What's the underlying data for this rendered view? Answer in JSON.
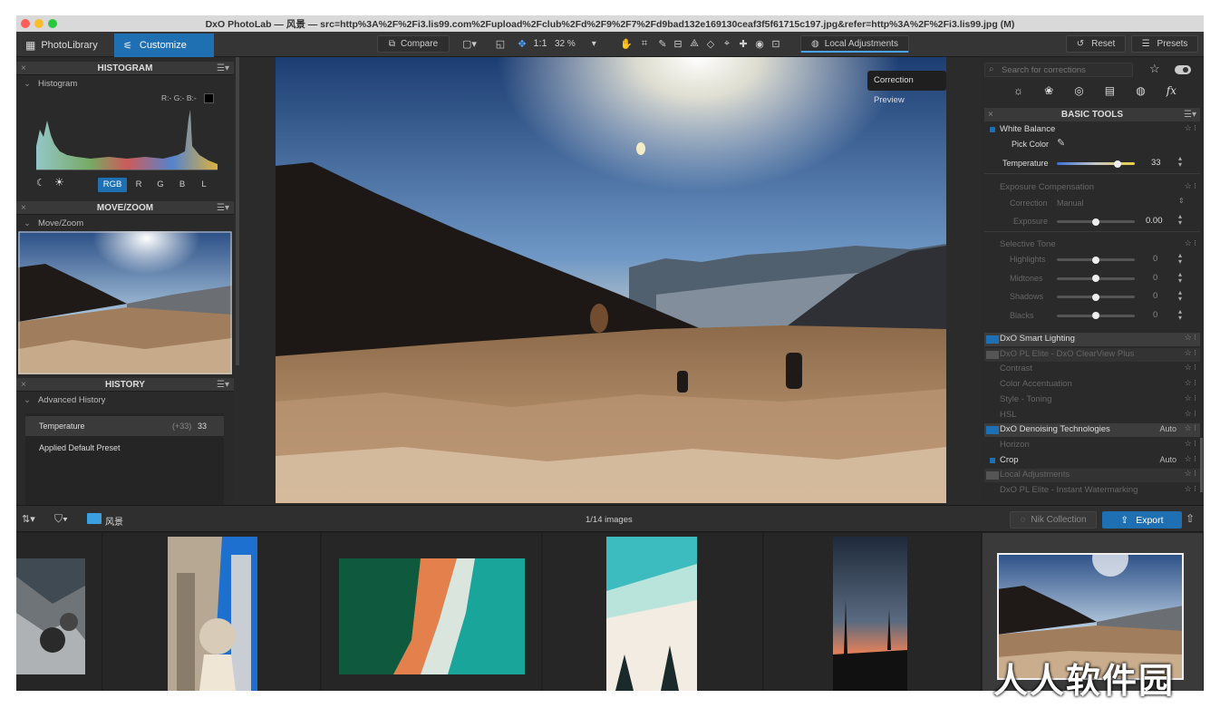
{
  "title": "DxO PhotoLab — 风景 — src=http%3A%2F%2Fi3.lis99.com%2Fupload%2Fclub%2Fd%2F9%2F7%2Fd9bad132e169130ceaf3f5f61715c197.jpg&refer=http%3A%2F%2Fi3.lis99.jpg (M)",
  "tabs": {
    "library": "PhotoLibrary",
    "customize": "Customize"
  },
  "toolbar": {
    "compare": "Compare",
    "one_to_one": "1:1",
    "zoom": "32 %",
    "local_adjustments": "Local Adjustments",
    "reset": "Reset",
    "presets": "Presets"
  },
  "tooltip": "Correction Preview",
  "histogram": {
    "header": "HISTOGRAM",
    "sub": "Histogram",
    "rgb_readout": "R:- G:- B:-",
    "channels": [
      "RGB",
      "R",
      "G",
      "B",
      "L"
    ]
  },
  "movezoom": {
    "header": "MOVE/ZOOM",
    "sub": "Move/Zoom"
  },
  "history": {
    "header": "HISTORY",
    "sub": "Advanced History",
    "items": [
      {
        "label": "Temperature",
        "delta": "(+33)",
        "value": "33"
      },
      {
        "label": "Applied Default Preset",
        "delta": "",
        "value": ""
      }
    ]
  },
  "right": {
    "search_placeholder": "Search for corrections",
    "panel_header": "BASIC TOOLS",
    "white_balance": {
      "title": "White Balance",
      "pick_color": "Pick Color",
      "temperature_label": "Temperature",
      "temperature_value": "33",
      "temperature_level": 0.78
    },
    "exposure": {
      "title": "Exposure Compensation",
      "correction_label": "Correction",
      "correction_value": "Manual",
      "exposure_label": "Exposure",
      "exposure_value": "0.00",
      "exposure_level": 0.5
    },
    "selective_tone": {
      "title": "Selective Tone",
      "rows": [
        {
          "label": "Highlights",
          "value": "0",
          "level": 0.5
        },
        {
          "label": "Midtones",
          "value": "0",
          "level": 0.5
        },
        {
          "label": "Shadows",
          "value": "0",
          "level": 0.5
        },
        {
          "label": "Blacks",
          "value": "0",
          "level": 0.5
        }
      ]
    },
    "tools": [
      {
        "label": "DxO Smart Lighting",
        "auto": "",
        "state": "active"
      },
      {
        "label": "DxO PL Elite - DxO ClearView Plus",
        "auto": "",
        "state": "dim-hl"
      },
      {
        "label": "Contrast",
        "auto": "",
        "state": "dim"
      },
      {
        "label": "Color Accentuation",
        "auto": "",
        "state": "dim"
      },
      {
        "label": "Style - Toning",
        "auto": "",
        "state": "dim"
      },
      {
        "label": "HSL",
        "auto": "",
        "state": "dim"
      },
      {
        "label": "DxO Denoising Technologies",
        "auto": "Auto",
        "state": "active"
      },
      {
        "label": "Horizon",
        "auto": "",
        "state": "dim"
      },
      {
        "label": "Crop",
        "auto": "Auto",
        "state": "on"
      },
      {
        "label": "Local Adjustments",
        "auto": "",
        "state": "dim-hl"
      },
      {
        "label": "DxO PL Elite - Instant Watermarking",
        "auto": "",
        "state": "dim"
      }
    ]
  },
  "filmstrip": {
    "folder": "风景",
    "count": "1/14 images",
    "nik": "Nik Collection",
    "export": "Export"
  },
  "watermark": "人人软件园",
  "colors": {
    "accent": "#1f6fb3",
    "panel": "#2a2a2a"
  }
}
